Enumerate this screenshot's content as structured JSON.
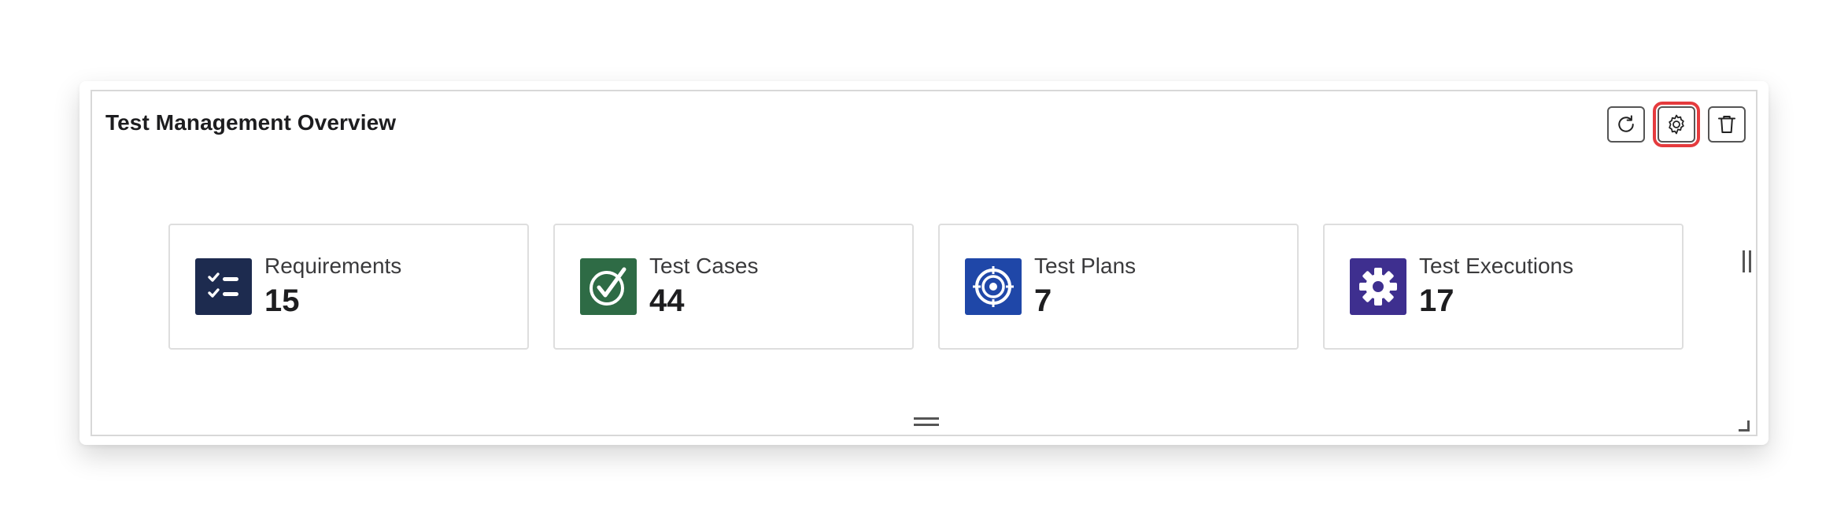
{
  "widget": {
    "title": "Test Management Overview"
  },
  "toolbar": {
    "refresh_icon": "refresh-icon",
    "settings_icon": "gear-icon",
    "delete_icon": "trash-icon",
    "highlight_color": "#e53b3e"
  },
  "cards": [
    {
      "label": "Requirements",
      "count": "15",
      "icon": "checklist-icon",
      "color": "#1d2b4f"
    },
    {
      "label": "Test Cases",
      "count": "44",
      "icon": "checkmark-circle-icon",
      "color": "#2e6b45"
    },
    {
      "label": "Test Plans",
      "count": "7",
      "icon": "target-icon",
      "color": "#1f47a8"
    },
    {
      "label": "Test Executions",
      "count": "17",
      "icon": "cog-icon",
      "color": "#3e2f8f"
    }
  ]
}
